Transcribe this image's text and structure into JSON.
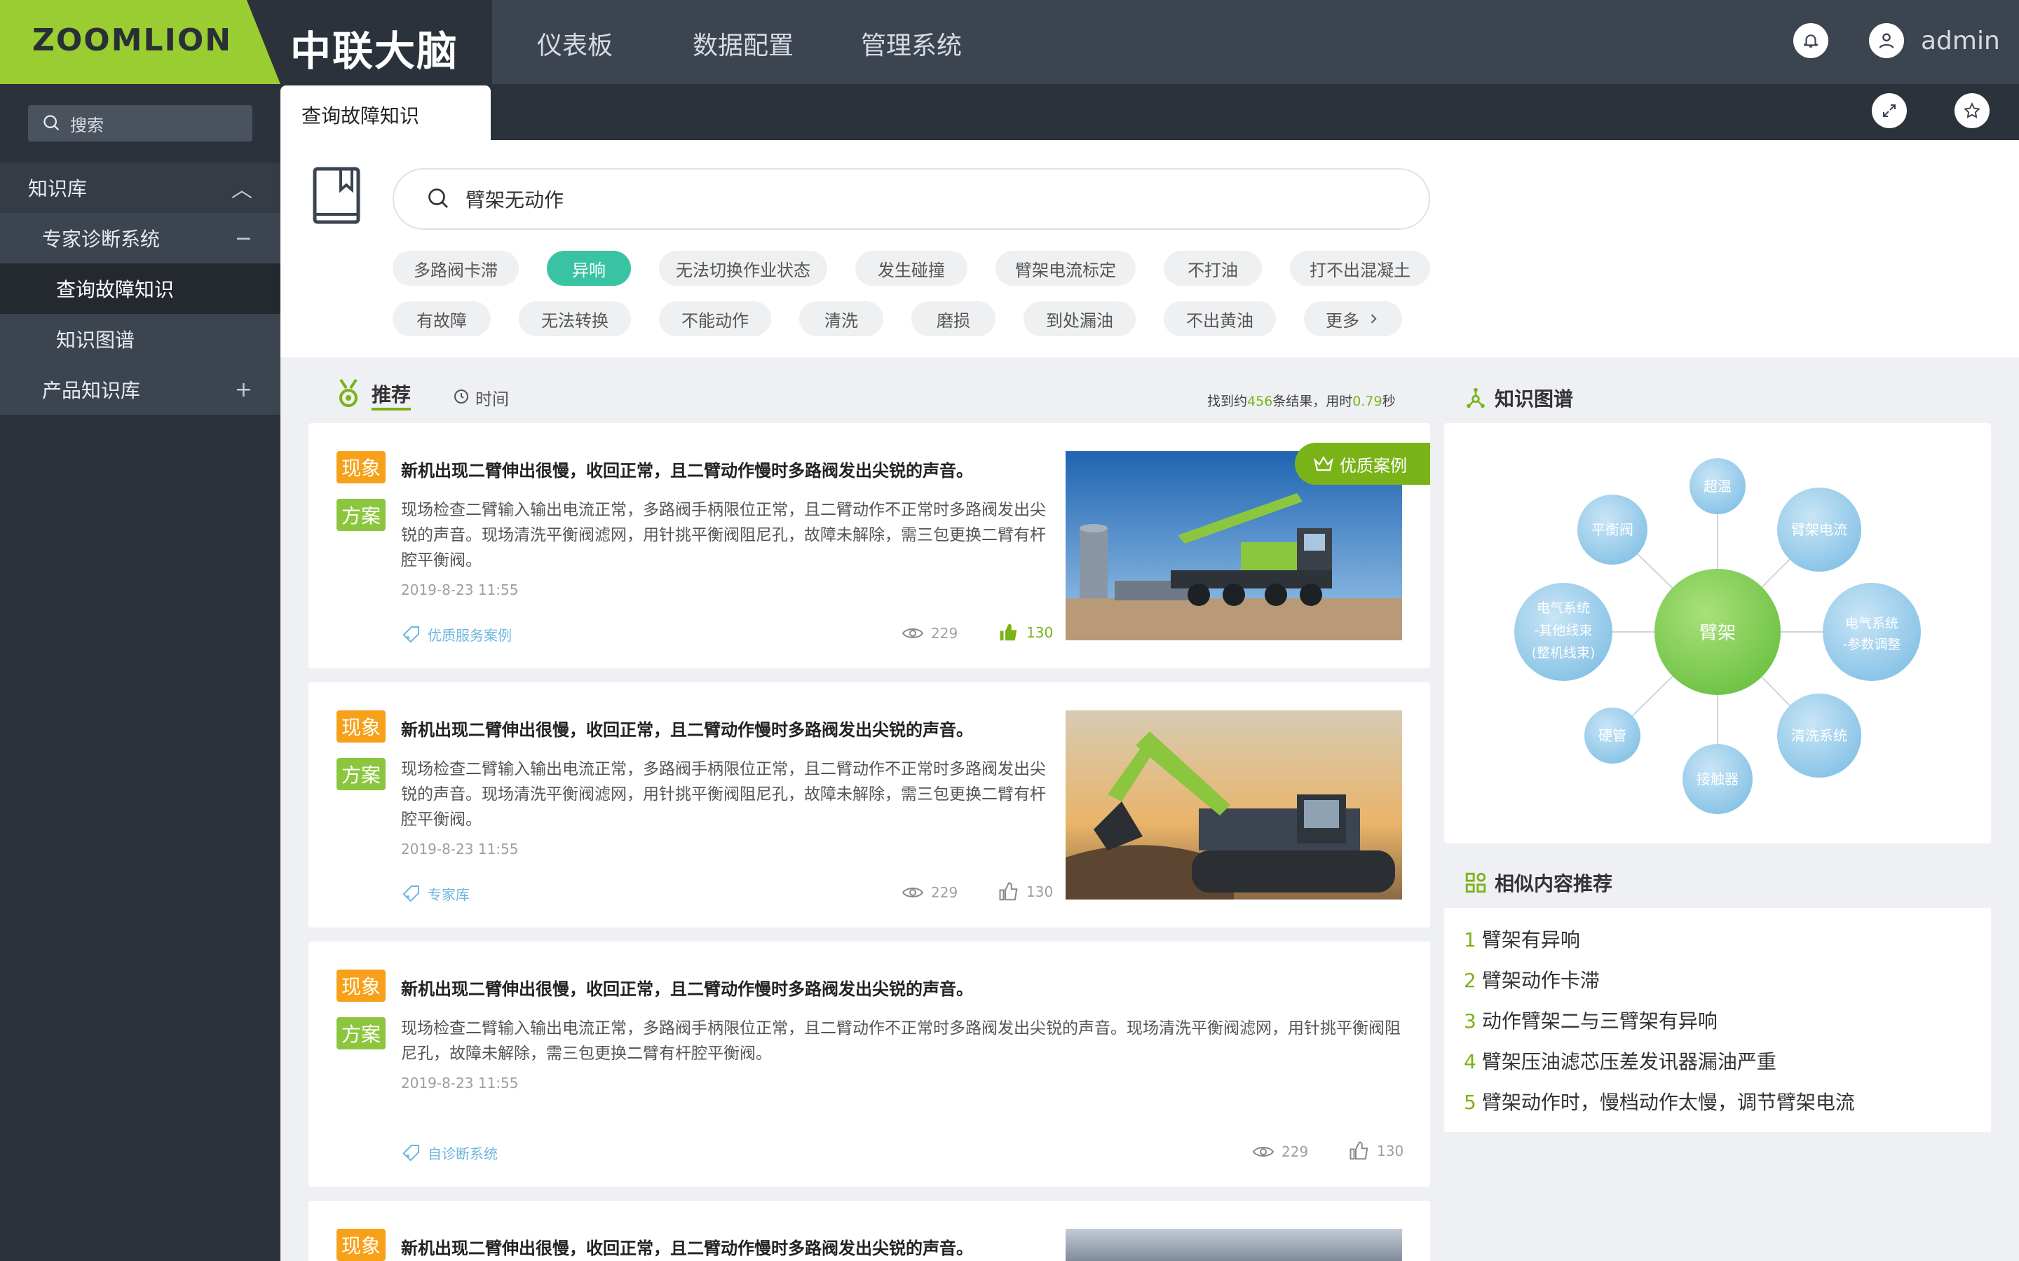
{
  "header": {
    "logo": "ZOOMLION",
    "brand": "中联大脑",
    "nav": [
      "仪表板",
      "数据配置",
      "管理系统"
    ],
    "user": "admin"
  },
  "tabs": {
    "active": "查询故障知识"
  },
  "sidebar": {
    "search_label": "搜索",
    "items": [
      {
        "label": "知识库",
        "toggle": "︿"
      },
      {
        "label": "专家诊断系统",
        "toggle": "−"
      },
      {
        "label": "查询故障知识"
      },
      {
        "label": "知识图谱"
      },
      {
        "label": "产品知识库",
        "toggle": "+"
      }
    ]
  },
  "search": {
    "value": "臂架无动作"
  },
  "tags": {
    "row1": [
      "多路阀卡滞",
      "异响",
      "无法切换作业状态",
      "发生碰撞",
      "臂架电流标定",
      "不打油",
      "打不出混凝土"
    ],
    "row2": [
      "有故障",
      "无法转换",
      "不能动作",
      "清洗",
      "磨损",
      "到处漏油",
      "不出黄油",
      "更多"
    ],
    "active": "异响"
  },
  "sort": {
    "recommend": "推荐",
    "time": "时间",
    "result_prefix": "找到约",
    "result_count": "456",
    "result_mid": "条结果，用时",
    "result_time": "0.79",
    "result_suffix": "秒"
  },
  "badges": {
    "phenomenon": "现象",
    "solution": "方案"
  },
  "cards": [
    {
      "title": "新机出现二臂伸出很慢，收回正常，且二臂动作慢时多路阀发出尖锐的声音。",
      "desc": "现场检查二臂输入输出电流正常，多路阀手柄限位正常，且二臂动作不正常时多路阀发出尖锐的声音。现场清洗平衡阀滤网，用针挑平衡阀阻尼孔，故障未解除，需三包更换二臂有杆腔平衡阀。",
      "date": "2019-8-23 11:55",
      "category": "优质服务案例",
      "views": "229",
      "likes": "130",
      "ribbon": "优质案例"
    },
    {
      "title": "新机出现二臂伸出很慢，收回正常，且二臂动作慢时多路阀发出尖锐的声音。",
      "desc": "现场检查二臂输入输出电流正常，多路阀手柄限位正常，且二臂动作不正常时多路阀发出尖锐的声音。现场清洗平衡阀滤网，用针挑平衡阀阻尼孔，故障未解除，需三包更换二臂有杆腔平衡阀。",
      "date": "2019-8-23 11:55",
      "category": "专家库",
      "views": "229",
      "likes": "130"
    },
    {
      "title": "新机出现二臂伸出很慢，收回正常，且二臂动作慢时多路阀发出尖锐的声音。",
      "desc": "现场检查二臂输入输出电流正常，多路阀手柄限位正常，且二臂动作不正常时多路阀发出尖锐的声音。现场清洗平衡阀滤网，用针挑平衡阀阻尼孔，故障未解除，需三包更换二臂有杆腔平衡阀。",
      "date": "2019-8-23 11:55",
      "category": "自诊断系统",
      "views": "229",
      "likes": "130"
    },
    {
      "title": "新机出现二臂伸出很慢，收回正常，且二臂动作慢时多路阀发出尖锐的声音。"
    }
  ],
  "graph": {
    "title": "知识图谱",
    "center": "臂架",
    "nodes": [
      "超温",
      "平衡阀",
      "臂架电流",
      "电气系统-其他线束(整机线束)",
      "电气系统-参数调整",
      "硬管",
      "清洗系统",
      "接触器"
    ],
    "node_lines": {
      "left_big": [
        "电气系统",
        "-其他线束",
        "(整机线束)"
      ],
      "right_big": [
        "电气系统",
        "-参数调整"
      ]
    }
  },
  "similar": {
    "title": "相似内容推荐",
    "items": [
      {
        "num": "1",
        "text": "臂架有异响"
      },
      {
        "num": "2",
        "text": "臂架动作卡滞"
      },
      {
        "num": "3",
        "text": "动作臂架二与三臂架有异响"
      },
      {
        "num": "4",
        "text": "臂架压油滤芯压差发讯器漏油严重"
      },
      {
        "num": "5",
        "text": "臂架动作时，慢档动作太慢，调节臂架电流"
      }
    ]
  },
  "colors": {
    "accent": "#7ab317",
    "tag_active": "#39c3a3",
    "badge_orange": "#f7a11a",
    "badge_green": "#8cc63f"
  }
}
